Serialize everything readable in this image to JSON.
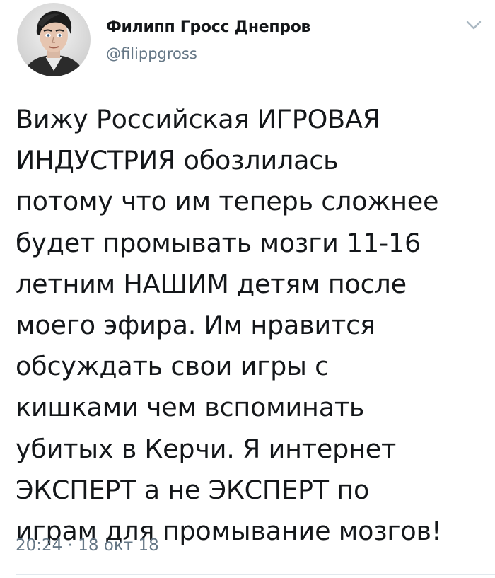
{
  "author": {
    "name": "Филипп Гросс Днепров",
    "handle": "@filippgross",
    "avatar_icon": "avatar-portrait"
  },
  "tweet": {
    "lines": [
      "Вижу Российская ИГРОВАЯ",
      "ИНДУСТРИЯ обозлилась",
      "потому что им теперь сложнее",
      "будет промывать мозги 11-16",
      "летним НАШИМ детям после",
      "моего эфира. Им нравится",
      "обсуждать свои игры с",
      "кишками чем вспоминать",
      "убитых в Керчи. Я интернет",
      "ЭКСПЕРТ а не ЭКСПЕРТ по",
      "играм для промывание мозгов!"
    ],
    "time": "20:24",
    "separator": "·",
    "date": "18 окт 18"
  },
  "menu": {
    "icon": "chevron-down-icon"
  },
  "colors": {
    "text": "#14171a",
    "secondary": "#657786",
    "divider": "#e1e8ed",
    "caret": "#aab8c2"
  }
}
